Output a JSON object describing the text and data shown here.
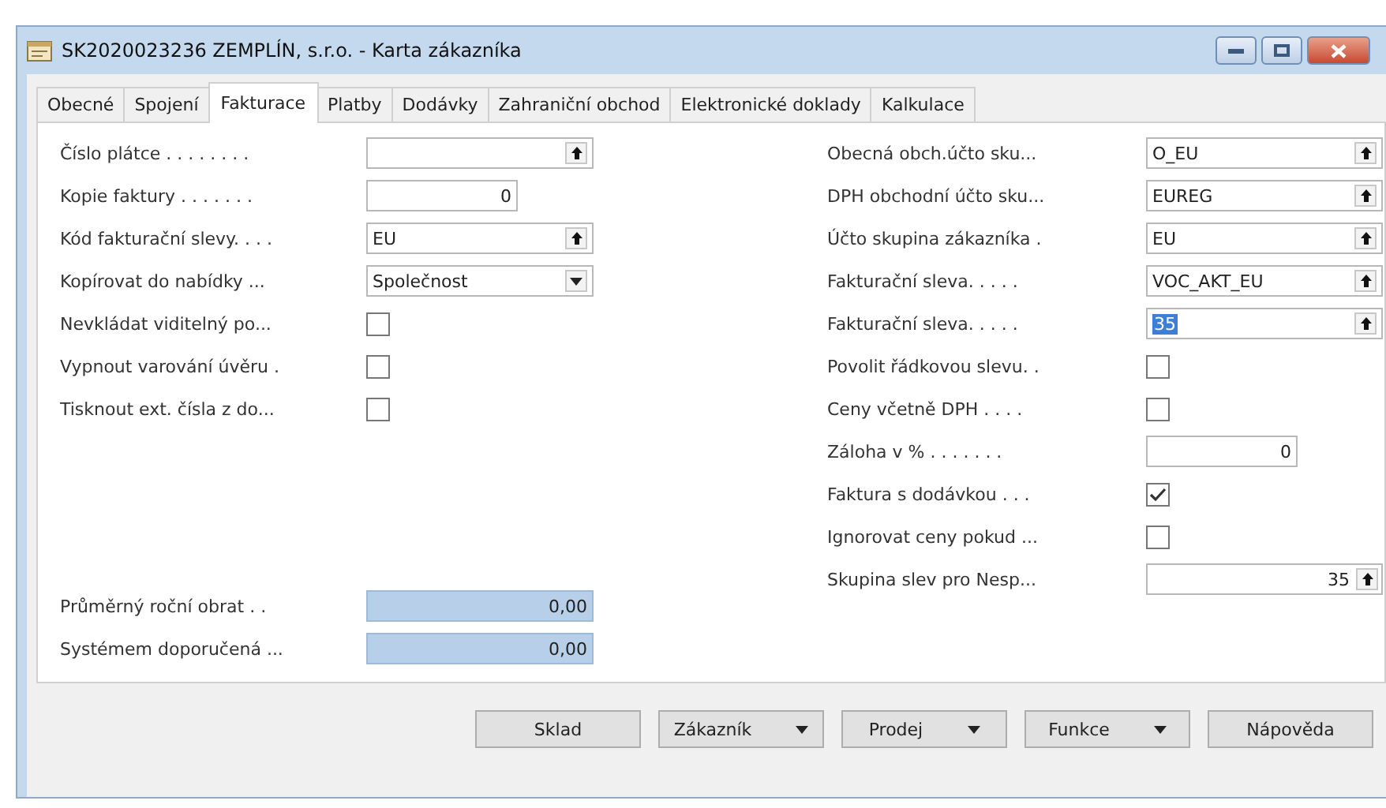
{
  "window": {
    "title": "SK2020023236 ZEMPLÍN, s.r.o. - Karta zákazníka"
  },
  "tabs": [
    {
      "label": "Obecné",
      "selected": false
    },
    {
      "label": "Spojení",
      "selected": false
    },
    {
      "label": "Fakturace",
      "selected": true
    },
    {
      "label": "Platby",
      "selected": false
    },
    {
      "label": "Dodávky",
      "selected": false
    },
    {
      "label": "Zahraniční obchod",
      "selected": false
    },
    {
      "label": "Elektronické doklady",
      "selected": false
    },
    {
      "label": "Kalkulace",
      "selected": false
    }
  ],
  "left_column": {
    "fields": [
      {
        "kind": "lookup",
        "label": "Číslo plátce . . . . . . . ."
      },
      {
        "kind": "number",
        "label": "Kopie faktury . . . . . . .",
        "value": "0"
      },
      {
        "kind": "lookup",
        "label": "Kód fakturační slevy. . . .",
        "value": "EU"
      },
      {
        "kind": "option",
        "label": "Kopírovat do nabídky ...",
        "value": "Společnost"
      },
      {
        "kind": "checkbox",
        "label": "Nevkládat viditelný po...",
        "checked": false
      },
      {
        "kind": "checkbox",
        "label": "Vypnout varování úvěru .",
        "checked": false
      },
      {
        "kind": "checkbox",
        "label": "Tisknout ext. čísla z do...",
        "checked": false
      }
    ],
    "footer_fields": [
      {
        "kind": "calculated",
        "label": "Průměrný roční obrat . .",
        "value": "0,00"
      },
      {
        "kind": "calculated",
        "label": "Systémem doporučená ...",
        "value": "0,00"
      }
    ]
  },
  "right_column": {
    "fields": [
      {
        "kind": "lookup",
        "label": "Obecná obch.účto sku...",
        "value": "O_EU"
      },
      {
        "kind": "lookup",
        "label": "DPH obchodní účto sku...",
        "value": "EUREG"
      },
      {
        "kind": "lookup",
        "label": "Účto skupina zákazníka .",
        "value": "EU"
      },
      {
        "kind": "lookup",
        "label": "Fakturační sleva. . . . .",
        "value": "VOC_AKT_EU"
      },
      {
        "kind": "lookup",
        "label": "Fakturační sleva. . . . .",
        "value": "35",
        "highlighted": true
      },
      {
        "kind": "checkbox",
        "label": "Povolit řádkovou slevu. .",
        "checked": false
      },
      {
        "kind": "checkbox",
        "label": "Ceny včetně DPH . . . .",
        "checked": false
      },
      {
        "kind": "number",
        "label": "Záloha v % . . . . . . .",
        "value": "0"
      },
      {
        "kind": "checkbox",
        "label": "Faktura s dodávkou . . .",
        "checked": true
      },
      {
        "kind": "checkbox",
        "label": "Ignorovat ceny pokud ...",
        "checked": false
      },
      {
        "kind": "number_lookup",
        "label": "Skupina slev pro Nesp...",
        "value": "35"
      }
    ]
  },
  "buttons": [
    {
      "label": "Sklad",
      "menu": false
    },
    {
      "label": "Zákazník",
      "menu": true
    },
    {
      "label": "Prodej",
      "menu": true
    },
    {
      "label": "Funkce",
      "menu": true
    },
    {
      "label": "Nápověda",
      "menu": false
    }
  ]
}
